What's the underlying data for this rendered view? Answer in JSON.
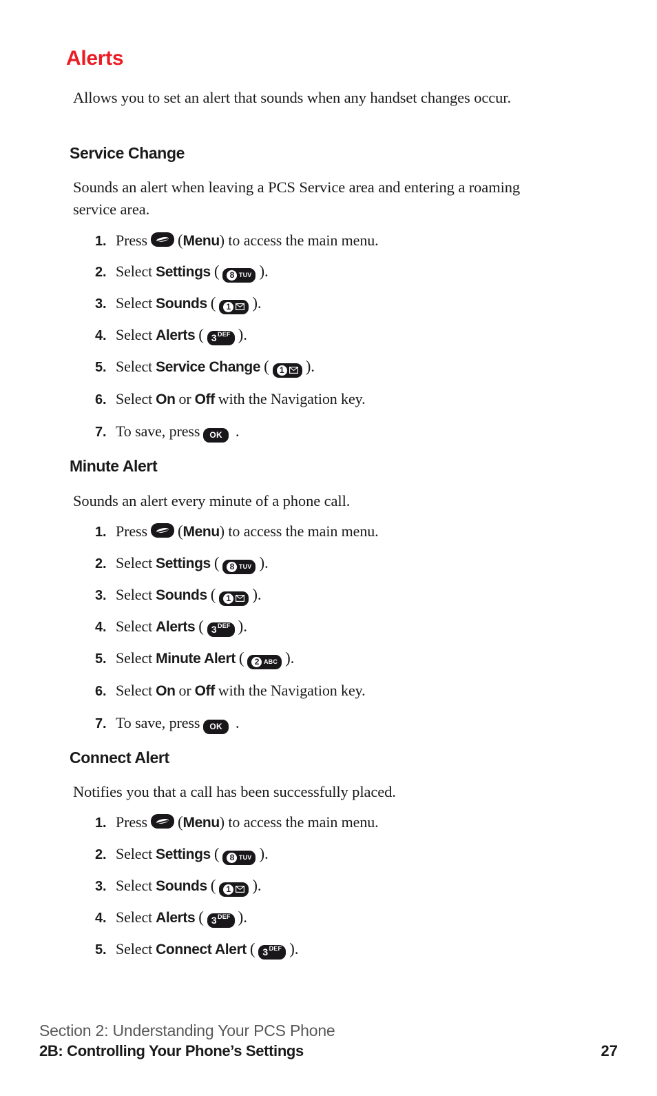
{
  "page": {
    "title": "Alerts",
    "title_color": "#ec1c24",
    "intro": "Allows you to set an alert that sounds when any handset changes occur."
  },
  "keys": {
    "menu": {
      "name": "menu-key",
      "label": "Menu"
    },
    "k8": {
      "digit": "8",
      "letters": "TUV"
    },
    "k1": {
      "digit": "1",
      "letters": "envelope"
    },
    "k3": {
      "digit": "3",
      "letters": "DEF"
    },
    "k2": {
      "digit": "2",
      "letters": "ABC"
    },
    "ok": {
      "label": "OK"
    }
  },
  "sections": [
    {
      "heading": "Service Change",
      "description": "Sounds an alert when leaving a PCS Service area and entering a roaming service area.",
      "steps": [
        {
          "num": "1.",
          "pre": "Press",
          "key": "menu",
          "post_paren": "(",
          "term": "Menu",
          "post": ") to access the main menu."
        },
        {
          "num": "2.",
          "pre": "Select",
          "term": "Settings",
          "key": "k8",
          "post": ""
        },
        {
          "num": "3.",
          "pre": "Select",
          "term": "Sounds",
          "key": "k1",
          "post": ""
        },
        {
          "num": "4.",
          "pre": "Select",
          "term": "Alerts",
          "key": "k3",
          "post": ""
        },
        {
          "num": "5.",
          "pre": "Select",
          "term": "Service Change",
          "key": "k1",
          "post": ""
        },
        {
          "num": "6.",
          "pre": "Select",
          "term": "On",
          "mid": "or",
          "term2": "Off",
          "post": "with the Navigation key."
        },
        {
          "num": "7.",
          "pre": "To save, press",
          "key": "ok",
          "post": "."
        }
      ]
    },
    {
      "heading": "Minute Alert",
      "description": "Sounds an alert every minute of a phone call.",
      "steps": [
        {
          "num": "1.",
          "pre": "Press",
          "key": "menu",
          "post_paren": "(",
          "term": "Menu",
          "post": ") to access the main menu."
        },
        {
          "num": "2.",
          "pre": "Select",
          "term": "Settings",
          "key": "k8",
          "post": ""
        },
        {
          "num": "3.",
          "pre": "Select",
          "term": "Sounds",
          "key": "k1",
          "post": ""
        },
        {
          "num": "4.",
          "pre": "Select",
          "term": "Alerts",
          "key": "k3",
          "post": ""
        },
        {
          "num": "5.",
          "pre": "Select",
          "term": "Minute Alert",
          "key": "k2",
          "post": ""
        },
        {
          "num": "6.",
          "pre": "Select",
          "term": "On",
          "mid": "or",
          "term2": "Off",
          "post": "with the Navigation key."
        },
        {
          "num": "7.",
          "pre": "To save, press",
          "key": "ok",
          "post": "."
        }
      ]
    },
    {
      "heading": "Connect Alert",
      "description": "Notifies you that a call has been successfully placed.",
      "steps": [
        {
          "num": "1.",
          "pre": "Press",
          "key": "menu",
          "post_paren": "(",
          "term": "Menu",
          "post": ") to access the main menu."
        },
        {
          "num": "2.",
          "pre": "Select",
          "term": "Settings",
          "key": "k8",
          "post": ""
        },
        {
          "num": "3.",
          "pre": "Select",
          "term": "Sounds",
          "key": "k1",
          "post": ""
        },
        {
          "num": "4.",
          "pre": "Select",
          "term": "Alerts",
          "key": "k3",
          "post": ""
        },
        {
          "num": "5.",
          "pre": "Select",
          "term": "Connect Alert",
          "key": "k3",
          "post": ""
        }
      ]
    }
  ],
  "footer": {
    "section_line": "Section 2: Understanding Your PCS Phone",
    "chapter_line": "2B: Controlling Your Phone’s Settings",
    "page_number": "27"
  }
}
